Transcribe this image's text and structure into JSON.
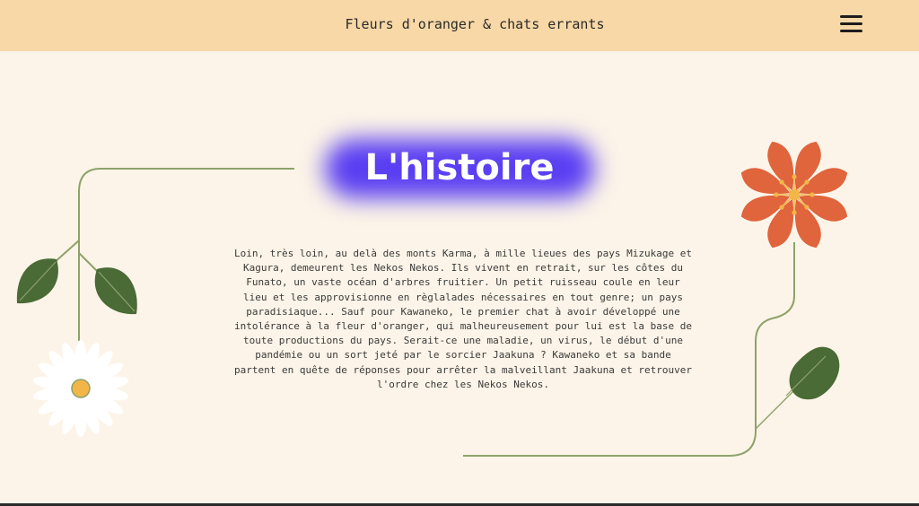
{
  "header": {
    "site_title": "Fleurs d'oranger & chats errants",
    "menu_icon": "hamburger-menu-icon"
  },
  "main": {
    "title": "L'histoire",
    "story": "Loin, très loin, au delà des monts Karma, à mille lieues des pays Mizukage et Kagura, demeurent les Nekos Nekos. Ils vivent en retrait, sur les côtes du Funato, un vaste océan d'arbres fruitier. Un petit ruisseau coule en leur lieu et les approvisionne en règlalades nécessaires en tout genre; un pays paradisiaque... Sauf pour Kawaneko, le premier chat à avoir développé une intolérance à la fleur d'oranger, qui malheureusement pour lui est la base de toute productions du pays. Serait-ce une maladie, un virus, le début d'une pandémie ou un sort jeté par le sorcier Jaakuna ? Kawaneko et sa bande partent en quête de réponses pour arrêter la malveillant Jaakuna et retrouver l'ordre chez les Nekos Nekos."
  },
  "colors": {
    "header_bg": "#f8d8a6",
    "page_bg": "#fcf4e8",
    "title_glow": "#5a3ef2",
    "leaf": "#4a6a36",
    "stem": "#8ea26a",
    "orange_flower": "#e0643c",
    "flower_center": "#f2b648"
  }
}
